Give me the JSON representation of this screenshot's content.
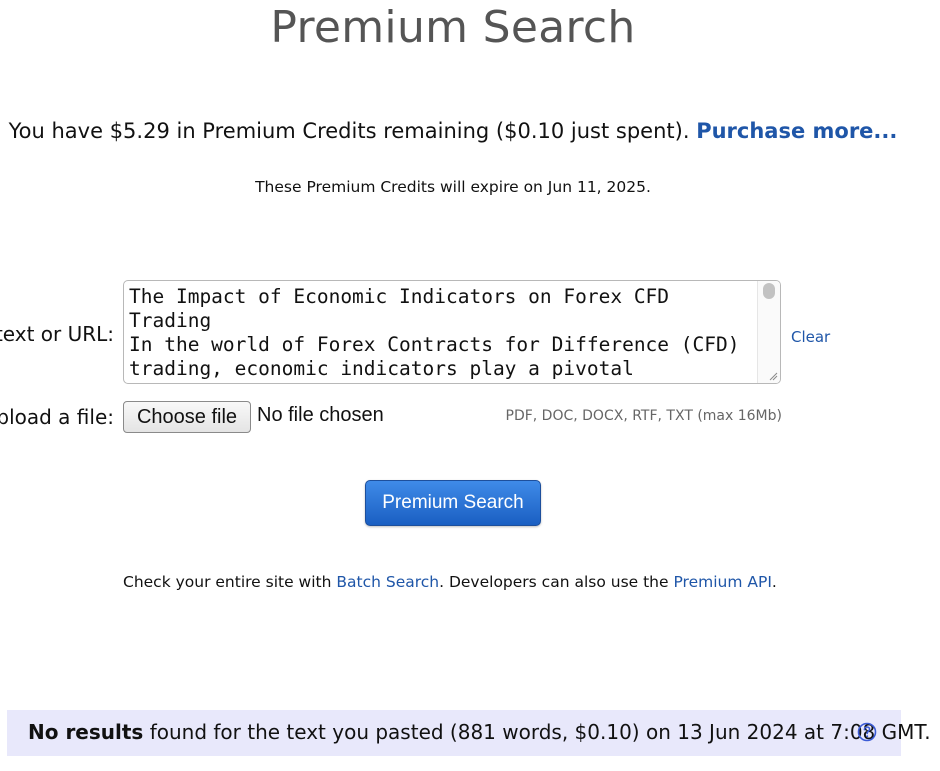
{
  "header": {
    "title": "Premium Search"
  },
  "credits": {
    "text": "You have $5.29 in Premium Credits remaining ($0.10 just spent).",
    "purchase_label": "Purchase more...",
    "expiry": "These Premium Credits will expire on Jun 11, 2025."
  },
  "form": {
    "text_label": "text or URL:",
    "text_value": "The Impact of Economic Indicators on Forex CFD Trading\nIn the world of Forex Contracts for Difference (CFD) trading, economic indicators play a pivotal",
    "clear_label": "Clear",
    "file_label": "upload a file:",
    "choose_file_label": "Choose file",
    "no_file_text": "No file chosen",
    "formats_text": "PDF, DOC, DOCX, RTF, TXT (max 16Mb)",
    "submit_label": "Premium Search"
  },
  "info": {
    "prefix": "Check your entire site with ",
    "batch_link": "Batch Search",
    "middle": ". Developers can also use the ",
    "api_link": "Premium API",
    "suffix": "."
  },
  "result": {
    "bold": "No results",
    "text": " found for the text you pasted (881 words, $0.10) on 13 Jun 2024 at 7:08 GMT."
  },
  "icons": {
    "help": "help-circle-icon",
    "resize": "resize-handle-icon"
  },
  "colors": {
    "link": "#1f56a8",
    "button": "#2a72d8",
    "result_background": "#e8e8fb",
    "title": "#555555"
  }
}
